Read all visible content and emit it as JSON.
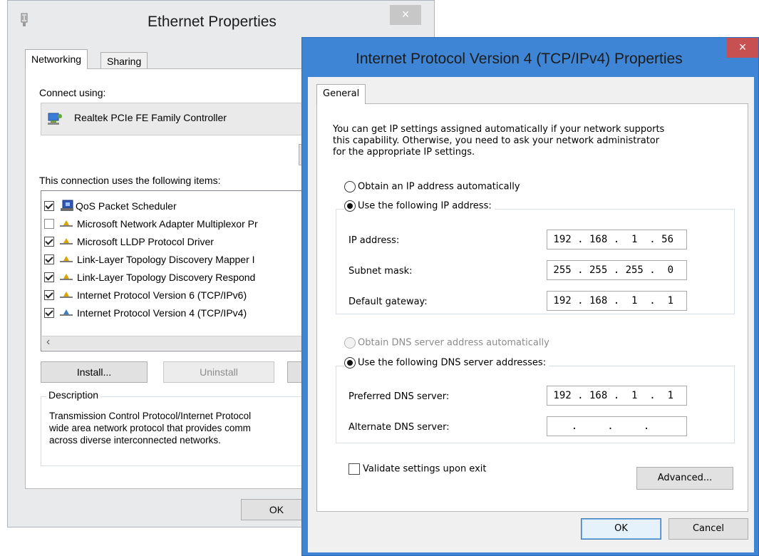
{
  "ethernet": {
    "title": "Ethernet Properties",
    "close_glyph": "×",
    "tabs": [
      {
        "label": "Networking"
      },
      {
        "label": "Sharing"
      }
    ],
    "connect_using_label": "Connect using:",
    "adapter": "Realtek PCIe FE Family Controller",
    "items_label": "This connection uses the following items:",
    "items": [
      {
        "checked": true,
        "label": "QoS Packet Scheduler",
        "icon": "qos-icon"
      },
      {
        "checked": false,
        "label": "Microsoft Network Adapter Multiplexor Pr",
        "icon": "network-protocol-icon"
      },
      {
        "checked": true,
        "label": "Microsoft LLDP Protocol Driver",
        "icon": "network-protocol-icon"
      },
      {
        "checked": true,
        "label": "Link-Layer Topology Discovery Mapper I",
        "icon": "network-protocol-icon"
      },
      {
        "checked": true,
        "label": "Link-Layer Topology Discovery Respond",
        "icon": "network-protocol-icon"
      },
      {
        "checked": true,
        "label": "Internet Protocol Version 6 (TCP/IPv6)",
        "icon": "network-protocol-icon"
      },
      {
        "checked": true,
        "label": "Internet Protocol Version 4 (TCP/IPv4)",
        "icon": "network-protocol-icon"
      }
    ],
    "scroll_left_glyph": "‹",
    "buttons": {
      "install": "Install...",
      "uninstall": "Uninstall"
    },
    "description_label": "Description",
    "description_lines": [
      "Transmission Control Protocol/Internet Protocol",
      "wide area network protocol that provides comm",
      "across diverse interconnected networks."
    ],
    "ok_label": "OK"
  },
  "ipv4": {
    "title": "Internet Protocol Version 4 (TCP/IPv4) Properties",
    "close_glyph": "×",
    "tab": "General",
    "intro_lines": [
      "You can get IP settings assigned automatically if your network supports",
      "this capability. Otherwise, you need to ask your network administrator",
      "for the appropriate IP settings."
    ],
    "radio_obtain_ip": "Obtain an IP address automatically",
    "radio_use_ip": "Use the following IP address:",
    "ip_address_label": "IP address:",
    "ip_address": "192 . 168 .  1  . 56",
    "subnet_label": "Subnet mask:",
    "subnet": "255 . 255 . 255 .  0",
    "gateway_label": "Default gateway:",
    "gateway": "192 . 168 .  1  .  1",
    "radio_obtain_dns": "Obtain DNS server address automatically",
    "radio_use_dns": "Use the following DNS server addresses:",
    "preferred_dns_label": "Preferred DNS server:",
    "preferred_dns": "192 . 168 .  1  .  1",
    "alternate_dns_label": "Alternate DNS server:",
    "alternate_dns": "  .     .     .    ",
    "validate_label": "Validate settings upon exit",
    "advanced_label": "Advanced...",
    "ok_label": "OK",
    "cancel_label": "Cancel"
  }
}
